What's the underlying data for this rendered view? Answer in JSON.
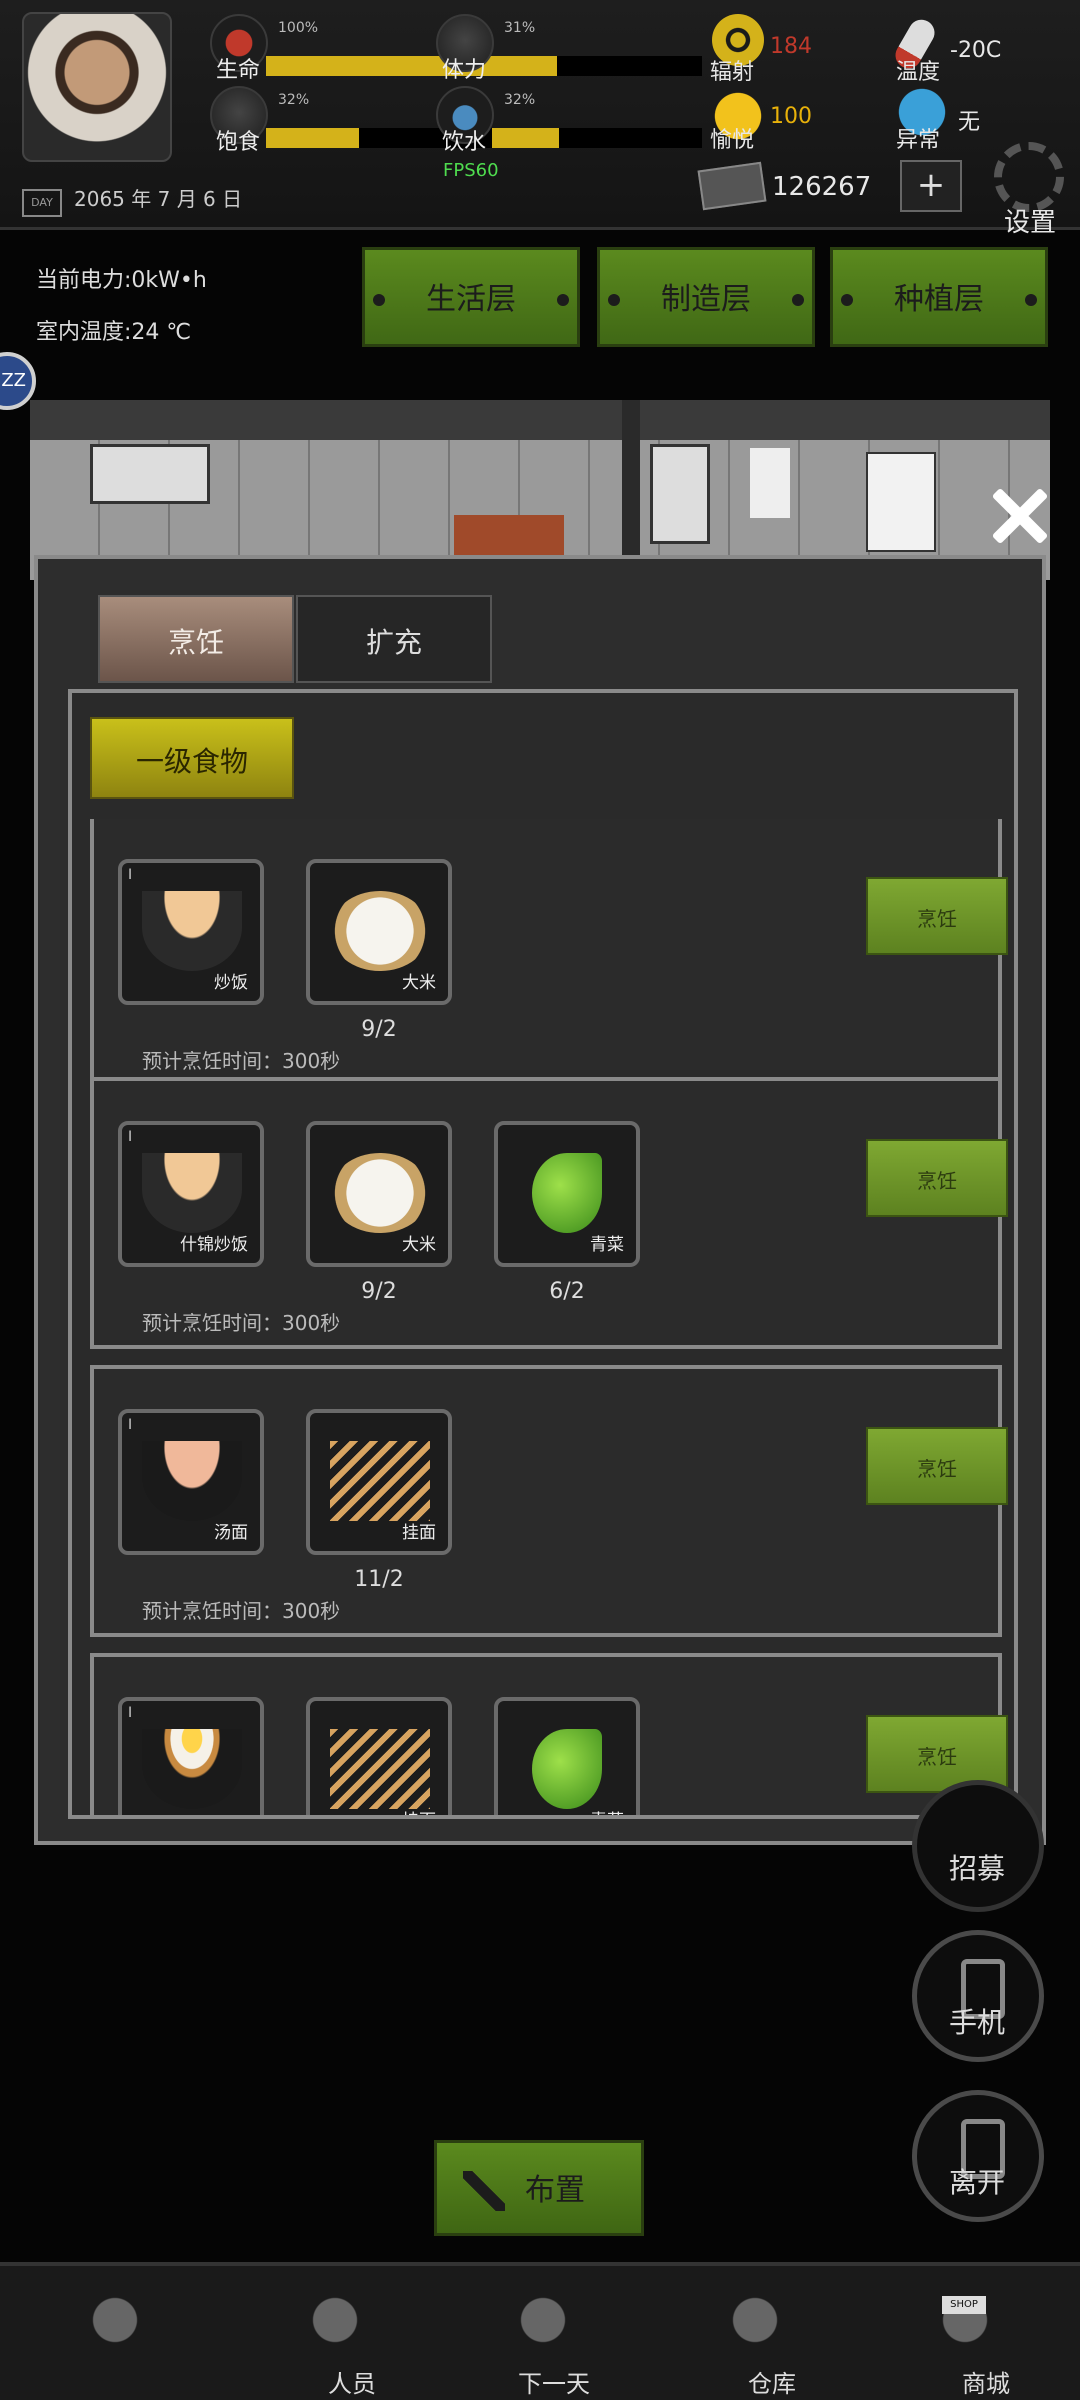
{
  "hud": {
    "stats": [
      {
        "label": "生命",
        "percent": "100%",
        "value": 1.0,
        "icon": "heart-icon"
      },
      {
        "label": "饱食",
        "percent": "32%",
        "value": 0.32,
        "icon": "stomach-icon"
      },
      {
        "label": "体力",
        "percent": "31%",
        "value": 0.31,
        "icon": "muscle-icon"
      },
      {
        "label": "饮水",
        "percent": "32%",
        "value": 0.32,
        "icon": "water-drop-icon"
      }
    ],
    "fps": "FPS60",
    "radiation": {
      "label": "辐射",
      "value": "184",
      "color": "#c0392b"
    },
    "happiness": {
      "label": "愉悦",
      "value": "100",
      "color": "#e8b10a"
    },
    "money": "126267",
    "temperature": {
      "label": "温度",
      "value": "-20C"
    },
    "abnormal": {
      "label": "异常",
      "value": "无"
    },
    "date": "2065 年 7 月 6 日",
    "day_icon": "DAY",
    "plus": "+",
    "settings": "设置"
  },
  "status": {
    "power": "当前电力:0kW•h",
    "indoor_temp": "室内温度:24 ℃"
  },
  "layers": [
    "生活层",
    "制造层",
    "种植层"
  ],
  "side_badge": "ZZ",
  "panel": {
    "tabs": [
      "烹饪",
      "扩充"
    ],
    "level": "一级食物",
    "recipes": [
      {
        "dish": "炒饭",
        "ingredients": [
          {
            "name": "大米",
            "qty": "9/2"
          }
        ],
        "time": "预计烹饪时间：300秒",
        "button": "烹饪"
      },
      {
        "dish": "什锦炒饭",
        "ingredients": [
          {
            "name": "大米",
            "qty": "9/2"
          },
          {
            "name": "青菜",
            "qty": "6/2"
          }
        ],
        "time": "预计烹饪时间：300秒",
        "button": "烹饪"
      },
      {
        "dish": "汤面",
        "ingredients": [
          {
            "name": "挂面",
            "qty": "11/2"
          }
        ],
        "time": "预计烹饪时间：300秒",
        "button": "烹饪"
      },
      {
        "dish": "",
        "ingredients": [
          {
            "name": "挂面",
            "qty": ""
          },
          {
            "name": "青菜",
            "qty": ""
          }
        ],
        "time": "",
        "button": "烹饪"
      }
    ]
  },
  "float_buttons": [
    "招募",
    "手机",
    "离开"
  ],
  "place_button": "布置",
  "nav": [
    "",
    "人员",
    "下一天",
    "仓库",
    "商城"
  ],
  "shop_sign": "SHOP"
}
